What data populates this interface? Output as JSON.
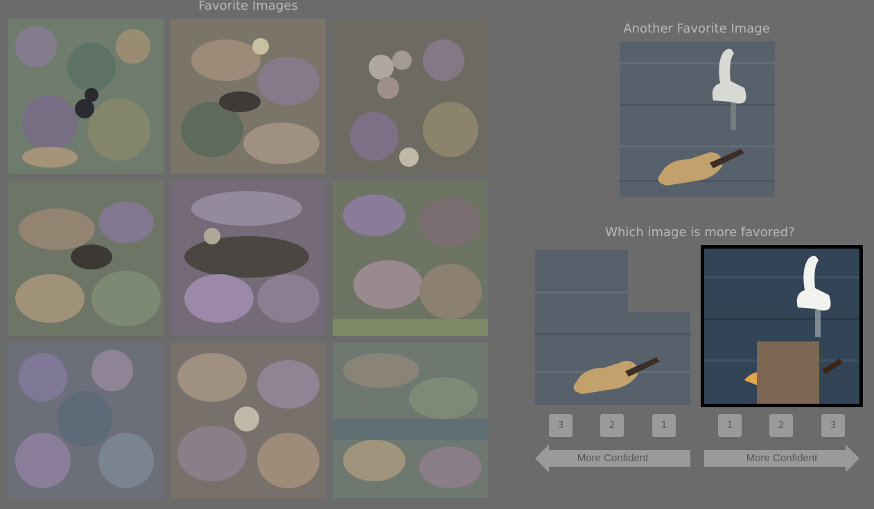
{
  "favorites": {
    "title": "Favorite Images",
    "tiles": [
      "psychedelic-birds-1",
      "psychedelic-birds-2",
      "psychedelic-birds-3",
      "psychedelic-birds-4",
      "psychedelic-birds-5",
      "psychedelic-birds-6",
      "psychedelic-birds-7",
      "psychedelic-birds-8",
      "psychedelic-birds-9"
    ]
  },
  "another": {
    "title": "Another Favorite Image"
  },
  "question": {
    "title": "Which image is more favored?"
  },
  "left_scale": {
    "buttons": [
      "3",
      "2",
      "1"
    ],
    "label": "More Confident"
  },
  "right_scale": {
    "buttons": [
      "1",
      "2",
      "3"
    ],
    "label": "More Confident"
  },
  "colors": {
    "background": "#6b6b6b",
    "title_text": "#b9b9b9",
    "selected_border": "#000000",
    "button_bg": "#9a9a9a"
  }
}
